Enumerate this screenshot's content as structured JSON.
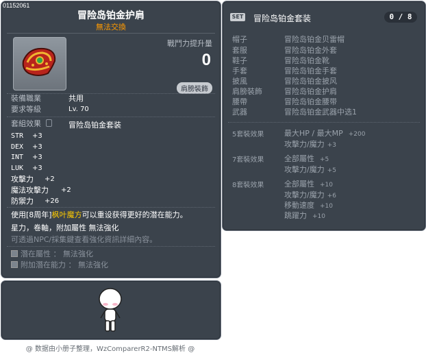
{
  "item": {
    "id": "01152061",
    "name": "冒险岛铂金护肩",
    "trade": "無法交換",
    "power_label": "戰鬥力提升量",
    "power_value": "0",
    "slot_badge": "肩膀裝飾",
    "job_label": "裝備職業",
    "job_value": "共用",
    "level_label": "要求等級",
    "level_value": "Lv. 70",
    "set_label": "套組效果",
    "set_name": "冒险岛铂金套装",
    "stats": [
      {
        "key": "STR",
        "value": "+3"
      },
      {
        "key": "DEX",
        "value": "+3"
      },
      {
        "key": "INT",
        "value": "+3"
      },
      {
        "key": "LUK",
        "value": "+3"
      },
      {
        "key": "攻擊力",
        "value": "+2"
      },
      {
        "key": "魔法攻擊力",
        "value": "+2"
      },
      {
        "key": "防禦力",
        "value": "+26"
      }
    ],
    "desc_prefix": "使用[8周年]",
    "desc_highlight": "枫叶魔方",
    "desc_suffix": "可以重设获得更好的潜在能力。",
    "flags": "星力，卷軸，附加屬性 無法強化",
    "hint": "可透過NPC/採集鍵查看強化資訊詳細內容。",
    "potential": "潛在屬性 ： 無法強化",
    "bonus_potential": "附加潛在能力 ： 無法強化"
  },
  "set_panel": {
    "badge": "SET",
    "title": "冒险岛铂金套装",
    "count": "0 / 8",
    "pieces": [
      {
        "slot": "帽子",
        "name": "冒险岛铂金贝雷帽"
      },
      {
        "slot": "套服",
        "name": "冒险岛铂金外套"
      },
      {
        "slot": "鞋子",
        "name": "冒险岛铂金靴"
      },
      {
        "slot": "手套",
        "name": "冒险岛铂金手套"
      },
      {
        "slot": "披風",
        "name": "冒险岛铂金披风"
      },
      {
        "slot": "肩膀裝飾",
        "name": "冒险岛铂金护肩"
      },
      {
        "slot": "腰帶",
        "name": "冒险岛铂金腰带"
      },
      {
        "slot": "武器",
        "name": "冒险岛铂金武器中选1"
      }
    ],
    "bonuses": [
      {
        "tier": "5套裝效果",
        "lines": [
          {
            "text": "最大HP / 最大MP",
            "num": "+200"
          },
          {
            "text": "攻擊力/魔力",
            "num": "+3"
          }
        ]
      },
      {
        "tier": "7套裝效果",
        "lines": [
          {
            "text": "全部屬性",
            "num": "+5"
          },
          {
            "text": "攻擊力/魔力",
            "num": "+5"
          }
        ]
      },
      {
        "tier": "8套裝效果",
        "lines": [
          {
            "text": "全部屬性",
            "num": "+10"
          },
          {
            "text": "攻擊力/魔力",
            "num": "+6"
          },
          {
            "text": "移動速度",
            "num": "+10"
          },
          {
            "text": "跳躍力",
            "num": "+10"
          }
        ]
      }
    ]
  },
  "footer": "@ 数据由小册子整理，WzComparerR2-NTMS解析 @",
  "colors": {
    "panel": "#3b434c",
    "trade": "#ff9a00",
    "highlight": "#ffcc00"
  }
}
